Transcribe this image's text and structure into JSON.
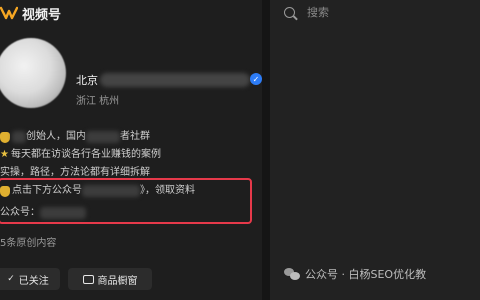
{
  "app": {
    "title": "视频号",
    "logo_icon": "butterfly-logo-icon",
    "accent": "#f5a623"
  },
  "profile": {
    "name_prefix": "北京",
    "location": "浙江 杭州",
    "verified_icon": "verified-badge-icon",
    "verified_color": "#2d7cf6"
  },
  "bio": {
    "line1_start": "创始人，国内",
    "line1_end": "者社群",
    "line2": "每天都在访谈各行各业赚钱的案例",
    "line3": "实操，路径，方法论都有详细拆解",
    "line4_start": "点击下方公众号",
    "line4_end": "》，领取资料",
    "line5": "公众号："
  },
  "original_count_text": "5条原创内容",
  "buttons": {
    "follow": "已关注",
    "shop": "商品橱窗"
  },
  "search": {
    "placeholder": "搜索"
  },
  "watermark": {
    "text": "公众号 · 白杨SEO优化教"
  },
  "highlight_color": "#e6394a"
}
